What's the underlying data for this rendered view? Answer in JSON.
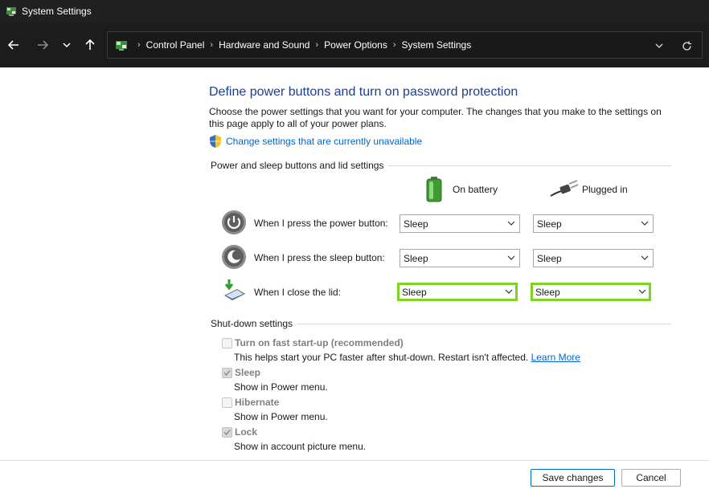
{
  "window": {
    "title": "System Settings"
  },
  "nav": {
    "back_icon": "arrow-left-icon",
    "forward_icon": "arrow-right-icon",
    "recent_icon": "chevron-down-icon",
    "up_icon": "arrow-up-icon",
    "breadcrumbs": [
      "Control Panel",
      "Hardware and Sound",
      "Power Options",
      "System Settings"
    ],
    "separator": "›",
    "refresh_icon": "refresh-icon"
  },
  "content": {
    "title": "Define power buttons and turn on password protection",
    "description": "Choose the power settings that you want for your computer. The changes that you make to the settings on this page apply to all of your power plans.",
    "change_settings_link": "Change settings that are currently unavailable"
  },
  "buttons_section": {
    "header": "Power and sleep buttons and lid settings",
    "columns": [
      "On battery",
      "Plugged in"
    ],
    "rows": [
      {
        "label": "When I press the power button:",
        "on_battery": "Sleep",
        "plugged_in": "Sleep",
        "icon": "power-button-icon"
      },
      {
        "label": "When I press the sleep button:",
        "on_battery": "Sleep",
        "plugged_in": "Sleep",
        "icon": "sleep-button-icon"
      },
      {
        "label": "When I close the lid:",
        "on_battery": "Sleep",
        "plugged_in": "Sleep",
        "icon": "laptop-lid-icon",
        "highlighted": true
      }
    ]
  },
  "shutdown_section": {
    "header": "Shut-down settings",
    "options": [
      {
        "title": "Turn on fast start-up (recommended)",
        "description": "This helps start your PC faster after shut-down. Restart isn't affected.",
        "link": "Learn More",
        "checked": false
      },
      {
        "title": "Sleep",
        "description": "Show in Power menu.",
        "checked": true
      },
      {
        "title": "Hibernate",
        "description": "Show in Power menu.",
        "checked": false
      },
      {
        "title": "Lock",
        "description": "Show in account picture menu.",
        "checked": true
      }
    ]
  },
  "footer": {
    "save_label": "Save changes",
    "cancel_label": "Cancel"
  },
  "colors": {
    "title_blue": "#1e3f8c",
    "link_blue": "#0066cc",
    "highlight_green": "#7ed321",
    "titlebar_bg": "#202020"
  }
}
